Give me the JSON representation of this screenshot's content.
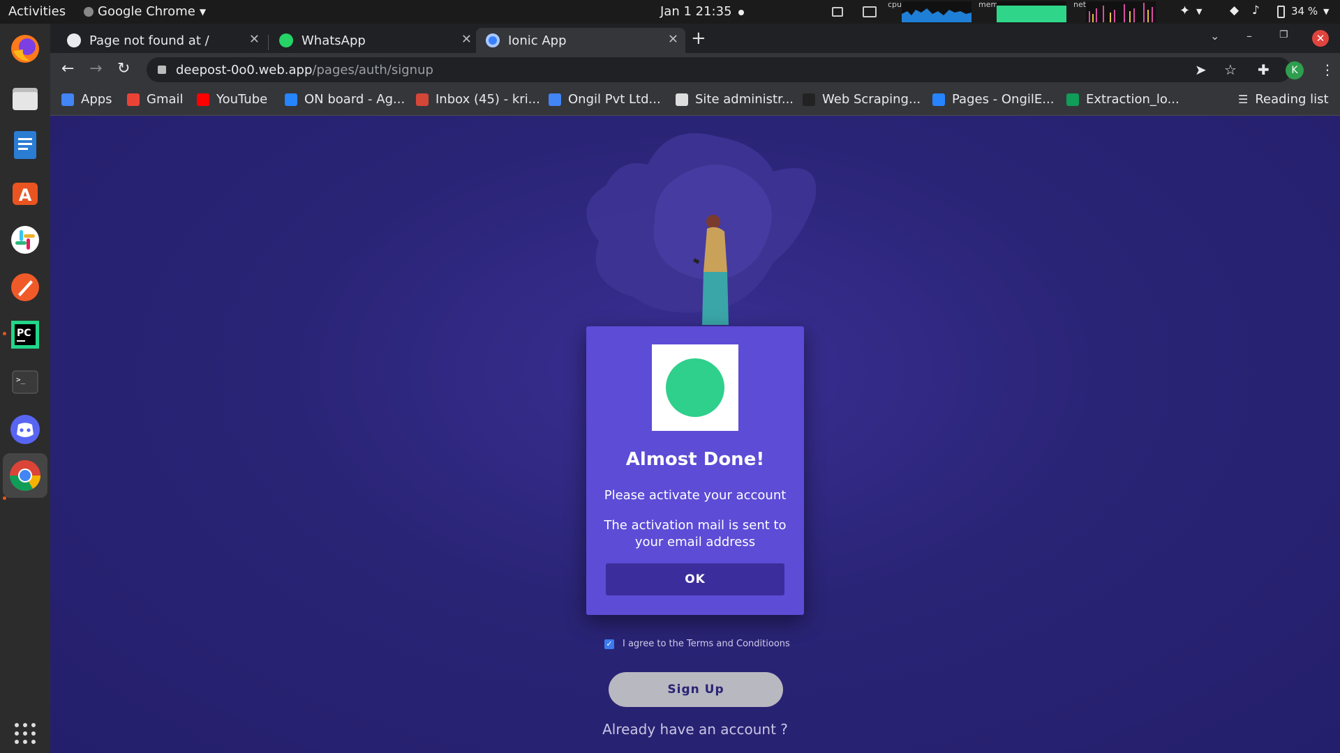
{
  "topbar": {
    "activities": "Activities",
    "app_menu": "Google Chrome",
    "clock": "Jan 1  21:35",
    "monitor_labels": {
      "cpu": "cpu",
      "mem": "mem",
      "net": "net"
    },
    "battery": "34 %"
  },
  "dock": {
    "items": [
      "firefox-icon",
      "files-icon",
      "writer-icon",
      "software-center-icon",
      "slack-icon",
      "drawing-icon",
      "pycharm-icon",
      "terminal-icon",
      "discord-icon",
      "chrome-icon",
      "show-apps-icon"
    ]
  },
  "browser": {
    "tabs": [
      {
        "title": "Page not found at /",
        "active": false
      },
      {
        "title": "WhatsApp",
        "active": false
      },
      {
        "title": "Ionic App",
        "active": true
      }
    ],
    "url_host": "deepost-0o0.web.app",
    "url_path": "/pages/auth/signup",
    "avatar_letter": "K",
    "bookmarks": [
      {
        "label": "Apps",
        "color": "#4285f4"
      },
      {
        "label": "Gmail",
        "color": "#ea4335"
      },
      {
        "label": "YouTube",
        "color": "#ff0000"
      },
      {
        "label": "ON board - Ag...",
        "color": "#2684ff"
      },
      {
        "label": "Inbox (45) - kri...",
        "color": "#d44638"
      },
      {
        "label": "Ongil Pvt Ltd...",
        "color": "#4285f4"
      },
      {
        "label": "Site administr...",
        "color": "#dddddd"
      },
      {
        "label": "Web Scraping...",
        "color": "#222222"
      },
      {
        "label": "Pages - OngilE...",
        "color": "#2684ff"
      },
      {
        "label": "Extraction_lo...",
        "color": "#0f9d58"
      }
    ],
    "reading_list": "Reading list"
  },
  "dialog": {
    "title": "Almost Done!",
    "message_1": "Please activate your account",
    "message_2": "The activation mail is sent to your email address",
    "ok_label": "OK"
  },
  "signup_form": {
    "terms_label": "I agree to the Terms and Conditioons",
    "terms_checked": true,
    "signup_label": "Sign Up",
    "login_link": "Already have an account ?"
  },
  "colors": {
    "page_bg": "#2a2476",
    "dialog_bg": "#5c4cd6",
    "ok_button": "#3b2e9c",
    "circle": "#2fcf8c"
  }
}
